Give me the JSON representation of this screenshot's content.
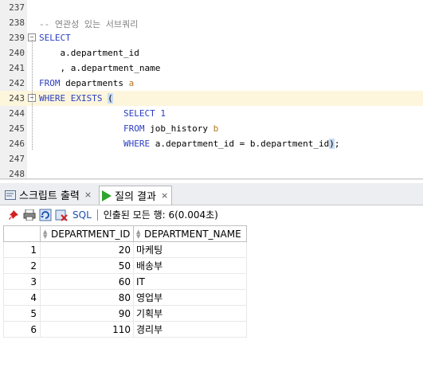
{
  "editor": {
    "lines": [
      {
        "num": "237",
        "segments": []
      },
      {
        "num": "238",
        "segments": [
          {
            "t": "-- 연관성 있는 서브쿼리",
            "c": "cm"
          }
        ]
      },
      {
        "num": "239",
        "segments": [
          {
            "t": "SELECT",
            "c": "kw"
          }
        ]
      },
      {
        "num": "240",
        "segments": [
          {
            "t": "    a.department_id",
            "c": ""
          }
        ]
      },
      {
        "num": "241",
        "segments": [
          {
            "t": "    , a.department_name",
            "c": ""
          }
        ]
      },
      {
        "num": "242",
        "segments": [
          {
            "t": "FROM",
            "c": "kw"
          },
          {
            "t": " departments ",
            "c": ""
          },
          {
            "t": "a",
            "c": "alias"
          }
        ]
      },
      {
        "num": "243",
        "segments": [
          {
            "t": "WHERE EXISTS",
            "c": "kw"
          },
          {
            "t": " ",
            "c": ""
          },
          {
            "t": "(",
            "c": "paren"
          }
        ]
      },
      {
        "num": "244",
        "segments": [
          {
            "t": "                ",
            "c": ""
          },
          {
            "t": "SELECT 1",
            "c": "kw"
          }
        ]
      },
      {
        "num": "245",
        "segments": [
          {
            "t": "                ",
            "c": ""
          },
          {
            "t": "FROM",
            "c": "kw"
          },
          {
            "t": " job_history ",
            "c": ""
          },
          {
            "t": "b",
            "c": "alias"
          }
        ]
      },
      {
        "num": "246",
        "segments": [
          {
            "t": "                ",
            "c": ""
          },
          {
            "t": "WHERE",
            "c": "kw"
          },
          {
            "t": " a.department_id = b.department_id",
            "c": ""
          },
          {
            "t": ")",
            "c": "paren"
          },
          {
            "t": ";",
            "c": ""
          }
        ]
      },
      {
        "num": "247",
        "segments": []
      },
      {
        "num": "248",
        "segments": []
      }
    ]
  },
  "tabs": [
    {
      "label": "스크립트 출력",
      "close": "×"
    },
    {
      "label": "질의 결과",
      "close": "×"
    }
  ],
  "toolbar": {
    "sql_label": "SQL",
    "status": "인출된 모든 행: 6(0.004초)"
  },
  "grid": {
    "columns": [
      "DEPARTMENT_ID",
      "DEPARTMENT_NAME"
    ],
    "rows": [
      {
        "n": "1",
        "id": "20",
        "name": "마케팅"
      },
      {
        "n": "2",
        "id": "50",
        "name": "배송부"
      },
      {
        "n": "3",
        "id": "60",
        "name": "IT"
      },
      {
        "n": "4",
        "id": "80",
        "name": "영업부"
      },
      {
        "n": "5",
        "id": "90",
        "name": "기획부"
      },
      {
        "n": "6",
        "id": "110",
        "name": "경리부"
      }
    ]
  },
  "colors": {
    "keyword": "#2a3ec2",
    "comment": "#808080",
    "current_line": "#fdf6dd"
  }
}
